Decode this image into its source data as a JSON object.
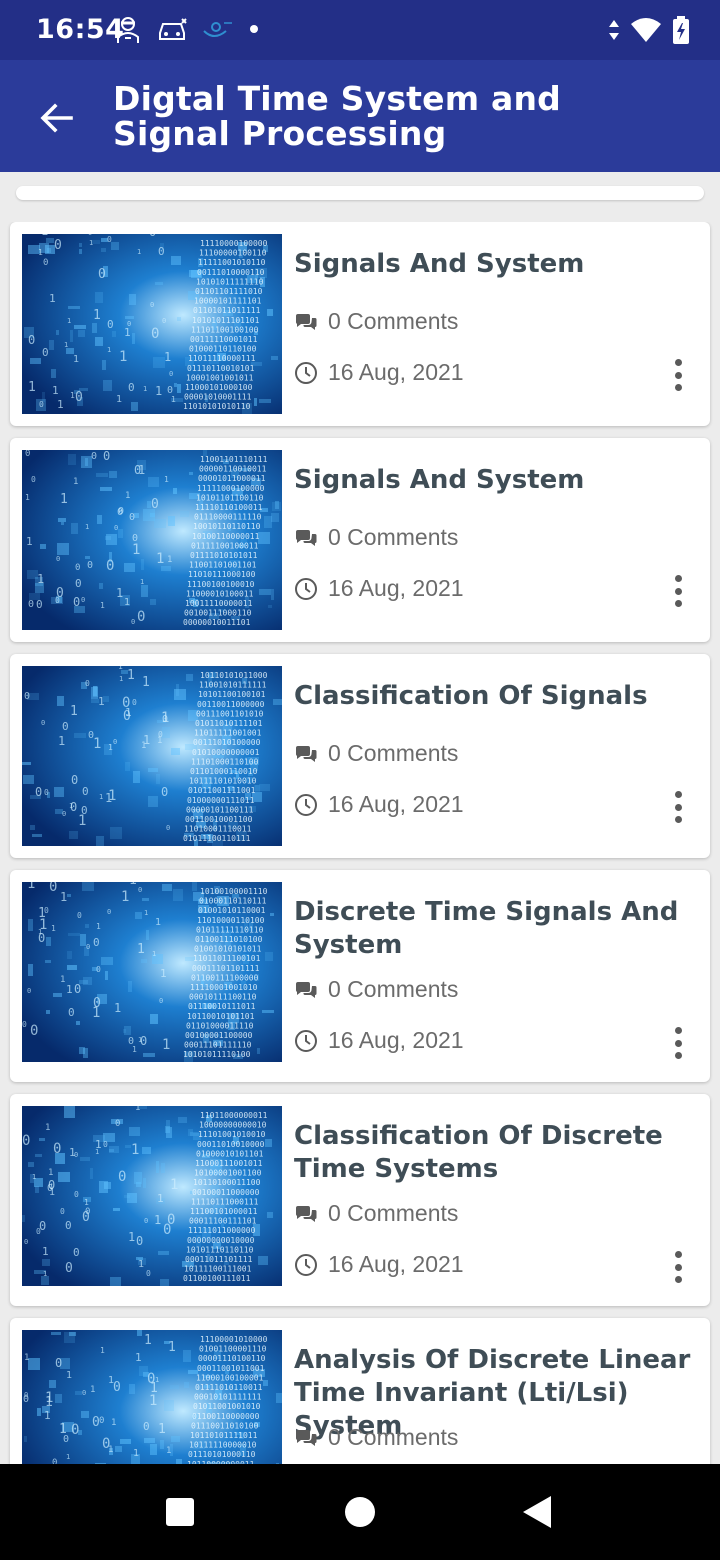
{
  "status_bar": {
    "time": "16:54",
    "left_icons": [
      "worker-icon",
      "car-icon",
      "app-icon",
      "dot-icon"
    ],
    "right_icons": [
      "data-arrows-icon",
      "wifi-icon",
      "battery-icon"
    ]
  },
  "app_bar": {
    "title": "Digtal Time System and Signal Processing",
    "back_icon": "arrow-back-icon"
  },
  "posts": [
    {
      "title": "Signals And System",
      "comments": "0 Comments",
      "date": "16 Aug, 2021"
    },
    {
      "title": "Signals And System",
      "comments": "0 Comments",
      "date": "16 Aug, 2021"
    },
    {
      "title": "Classification Of Signals",
      "comments": "0 Comments",
      "date": "16 Aug, 2021"
    },
    {
      "title": "Discrete Time Signals And System",
      "comments": "0 Comments",
      "date": "16 Aug, 2021"
    },
    {
      "title": "Classification Of Discrete Time Systems",
      "comments": "0 Comments",
      "date": "16 Aug, 2021"
    },
    {
      "title": "Analysis Of Discrete Linear Time Invariant (Lti/Lsi) System",
      "comments": "0 Comments",
      "date": ""
    }
  ],
  "icons": {
    "comments": "comments-icon",
    "clock": "clock-icon",
    "more": "more-vertical-icon"
  },
  "nav_bar": {
    "buttons": [
      "recents-square-icon",
      "home-circle-icon",
      "back-triangle-icon"
    ]
  },
  "colors": {
    "status_bar": "#232f87",
    "app_bar": "#2b3b9a",
    "background": "#ececec",
    "title_text": "#3f4d56",
    "meta_text": "#6b6b6b"
  }
}
